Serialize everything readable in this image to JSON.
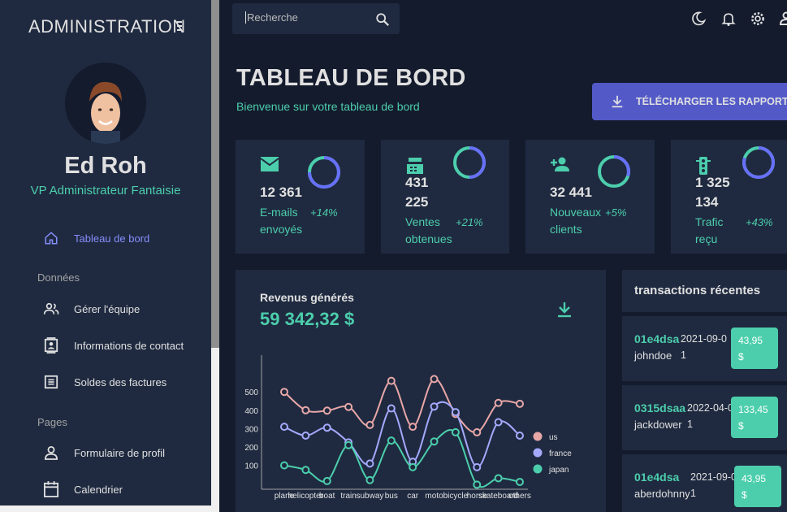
{
  "sidebar": {
    "title": "ADMINISTRATION",
    "user": {
      "name": "Ed Roh",
      "role": "VP Administrateur Fantaisie"
    },
    "items": [
      {
        "label": "Tableau de bord",
        "icon": "home-icon",
        "active": true
      },
      {
        "label": "Gérer l'équipe",
        "icon": "people-icon"
      },
      {
        "label": "Informations de contact",
        "icon": "contacts-icon"
      },
      {
        "label": "Soldes des factures",
        "icon": "receipt-icon"
      },
      {
        "label": "Formulaire de profil",
        "icon": "person-icon"
      },
      {
        "label": "Calendrier",
        "icon": "calendar-icon"
      }
    ],
    "sections": [
      "Données",
      "Pages"
    ]
  },
  "topbar": {
    "search_placeholder": "Recherche"
  },
  "header": {
    "title": "TABLEAU DE BORD",
    "subtitle": "Bienvenue sur votre tableau de bord",
    "download_label": "TÉLÉCHARGER LES RAPPORTS"
  },
  "stats": [
    {
      "value_line1": "12 361",
      "value_line2": "",
      "label_line1": "E-mails",
      "label_line2": "envoyés",
      "increase": "+14%",
      "progress": 0.75,
      "icon": "email-icon"
    },
    {
      "value_line1": "431",
      "value_line2": "225",
      "label_line1": "Ventes",
      "label_line2": "obtenues",
      "increase": "+21%",
      "progress": 0.5,
      "icon": "point-of-sale-icon"
    },
    {
      "value_line1": "32 441",
      "value_line2": "",
      "label_line1": "Nouveaux",
      "label_line2": "clients",
      "increase": "+5%",
      "progress": 0.3,
      "icon": "person-add-icon"
    },
    {
      "value_line1": "1 325",
      "value_line2": "134",
      "label_line1": "Trafic",
      "label_line2": "reçu",
      "increase": "+43%",
      "progress": 0.8,
      "icon": "traffic-icon"
    }
  ],
  "revenue": {
    "title": "Revenus générés",
    "value": "59 342,32 $"
  },
  "chart_data": {
    "type": "line",
    "categories": [
      "plane",
      "helicopter",
      "boat",
      "train",
      "subway",
      "bus",
      "car",
      "moto",
      "bicycle",
      "horse",
      "skateboard",
      "others"
    ],
    "series": [
      {
        "name": "us",
        "color": "#e8a7a7",
        "values": [
          500,
          400,
          398,
          418,
          320,
          560,
          310,
          570,
          380,
          280,
          440,
          435
        ]
      },
      {
        "name": "france",
        "color": "#a4a9fc",
        "values": [
          310,
          262,
          305,
          225,
          110,
          410,
          120,
          420,
          390,
          90,
          335,
          262
        ]
      },
      {
        "name": "japan",
        "color": "#4cceac",
        "values": [
          100,
          75,
          15,
          210,
          20,
          235,
          90,
          230,
          280,
          -5,
          30,
          10
        ]
      }
    ],
    "yticks": [
      100,
      200,
      300,
      400,
      500
    ],
    "ylim": [
      -30,
      700
    ]
  },
  "transactions": {
    "title": "transactions récentes",
    "rows": [
      {
        "id": "01e4dsa",
        "user": "johndoe",
        "date": "2021-09-01",
        "cost": "43,95 $"
      },
      {
        "id": "0315dsaa",
        "user": "jackdower",
        "date": "2022-04-01",
        "cost": "133,45 $"
      },
      {
        "id": "01e4dsa",
        "user": "aberdohnny",
        "date": "2021-09-01",
        "cost": "43,95 $"
      }
    ]
  }
}
